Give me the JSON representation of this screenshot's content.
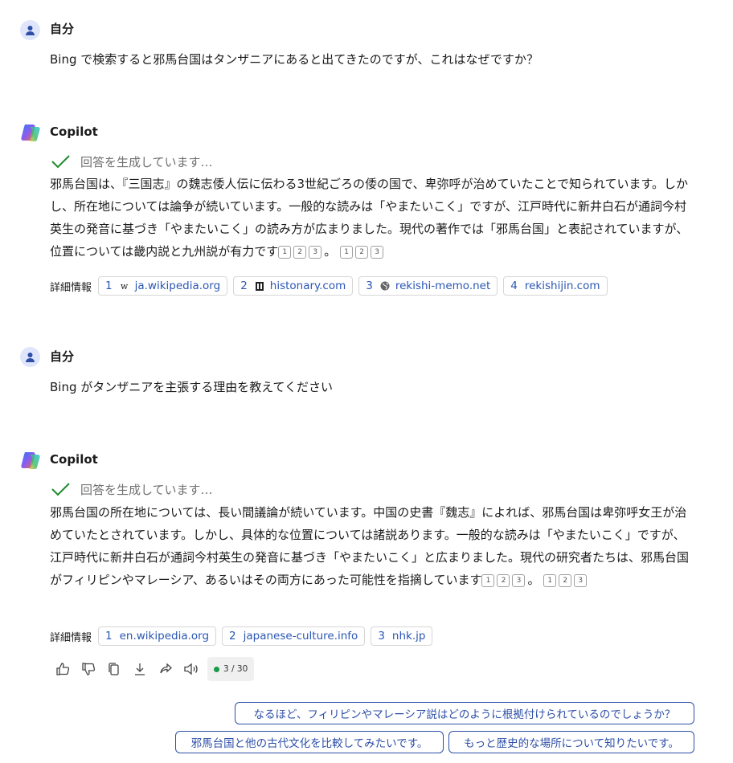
{
  "messages": [
    {
      "role": "user",
      "author": "自分",
      "text": "Bing で検索すると邪馬台国はタンザニアにあると出てきたのですが、これはなぜですか？"
    },
    {
      "role": "assistant",
      "author": "Copilot",
      "status": "回答を生成しています…",
      "answer_text": "邪馬台国は、『三国志』の魏志倭人伝に伝わる3世紀ごろの倭の国で、卑弥呼が治めていたことで知られています。しかし、所在地については論争が続いています。一般的な読みは「やまたいこく」ですが、江戸時代に新井白石が通詞今村英生の発音に基づき「やまたいこく」の読み方が広まりました。現代の著作では「邪馬台国」と表記されていますが、位置については畿内説と九州説が有力です",
      "citations_inline": [
        "1",
        "2",
        "3"
      ],
      "period": "。",
      "citations_after": [
        "1",
        "2",
        "3"
      ],
      "learn_more_label": "詳細情報",
      "sources": [
        {
          "num": "1",
          "icon": "wikipedia-icon",
          "label": "ja.wikipedia.org"
        },
        {
          "num": "2",
          "icon": "historny-icon",
          "label": "histonary.com"
        },
        {
          "num": "3",
          "icon": "globe-icon",
          "label": "rekishi-memo.net"
        },
        {
          "num": "4",
          "icon": "",
          "label": "rekishijin.com"
        }
      ]
    },
    {
      "role": "user",
      "author": "自分",
      "text": "Bing がタンザニアを主張する理由を教えてください"
    },
    {
      "role": "assistant",
      "author": "Copilot",
      "status": "回答を生成しています…",
      "answer_text": "邪馬台国の所在地については、長い間議論が続いています。中国の史書『魏志』によれば、邪馬台国は卑弥呼女王が治めていたとされています。しかし、具体的な位置については諸説あります。一般的な読みは「やまたいこく」ですが、江戸時代に新井白石が通詞今村英生の発音に基づき「やまたいこく」と広まりました。現代の研究者たちは、邪馬台国がフィリピンやマレーシア、あるいはその両方にあった可能性を指摘しています",
      "citations_inline": [
        "1",
        "2",
        "3"
      ],
      "period": "。",
      "citations_after": [
        "1",
        "2",
        "3"
      ],
      "learn_more_label": "詳細情報",
      "sources": [
        {
          "num": "1",
          "icon": "",
          "label": "en.wikipedia.org"
        },
        {
          "num": "2",
          "icon": "",
          "label": "japanese-culture.info"
        },
        {
          "num": "3",
          "icon": "",
          "label": "nhk.jp"
        }
      ]
    }
  ],
  "toolbar": {
    "icons": [
      "thumbs-up-icon",
      "thumbs-down-icon",
      "copy-icon",
      "download-icon",
      "share-icon",
      "speaker-icon"
    ],
    "page_count": "3 / 30",
    "status_color": "#1a9a4a"
  },
  "suggestions": [
    "なるほど、フィリピンやマレーシア説はどのように根拠付けられているのでしょうか？",
    "邪馬台国と他の古代文化を比較してみたいです。",
    "もっと歴史的な場所について知りたいです。"
  ],
  "colors": {
    "accent": "#2d4fa8",
    "link": "#2b57b4",
    "check": "#1f8a2e"
  }
}
